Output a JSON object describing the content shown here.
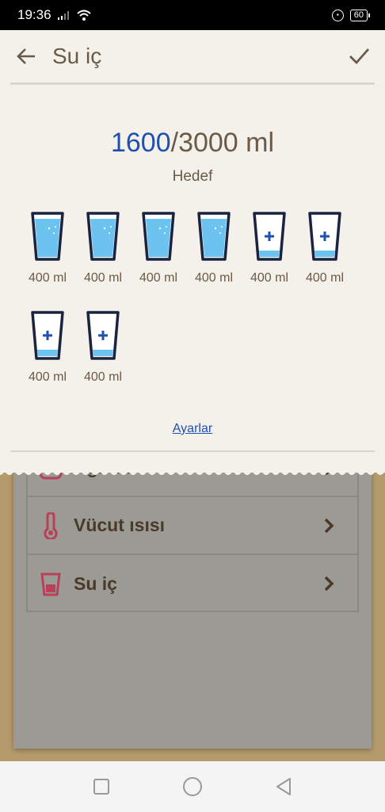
{
  "status_bar": {
    "time": "19:36",
    "battery": "60"
  },
  "header": {
    "title": "Su iç"
  },
  "progress": {
    "current": "1600",
    "separator": "/",
    "goal_text": "3000 ml",
    "goal_label": "Hedef"
  },
  "glasses": [
    {
      "label": "400 ml",
      "filled": true
    },
    {
      "label": "400 ml",
      "filled": true
    },
    {
      "label": "400 ml",
      "filled": true
    },
    {
      "label": "400 ml",
      "filled": true
    },
    {
      "label": "400 ml",
      "filled": false
    },
    {
      "label": "400 ml",
      "filled": false
    },
    {
      "label": "400 ml",
      "filled": false
    },
    {
      "label": "400 ml",
      "filled": false
    }
  ],
  "settings_link": "Ayarlar",
  "background_list": [
    {
      "label": "Ağırlık",
      "icon": "scale-icon"
    },
    {
      "label": "Vücut ısısı",
      "icon": "thermometer-icon"
    },
    {
      "label": "Su iç",
      "icon": "cup-icon"
    }
  ],
  "colors": {
    "accent_blue": "#1f4fb0",
    "water": "#6cc3f0",
    "icon_red": "#b8405a"
  }
}
